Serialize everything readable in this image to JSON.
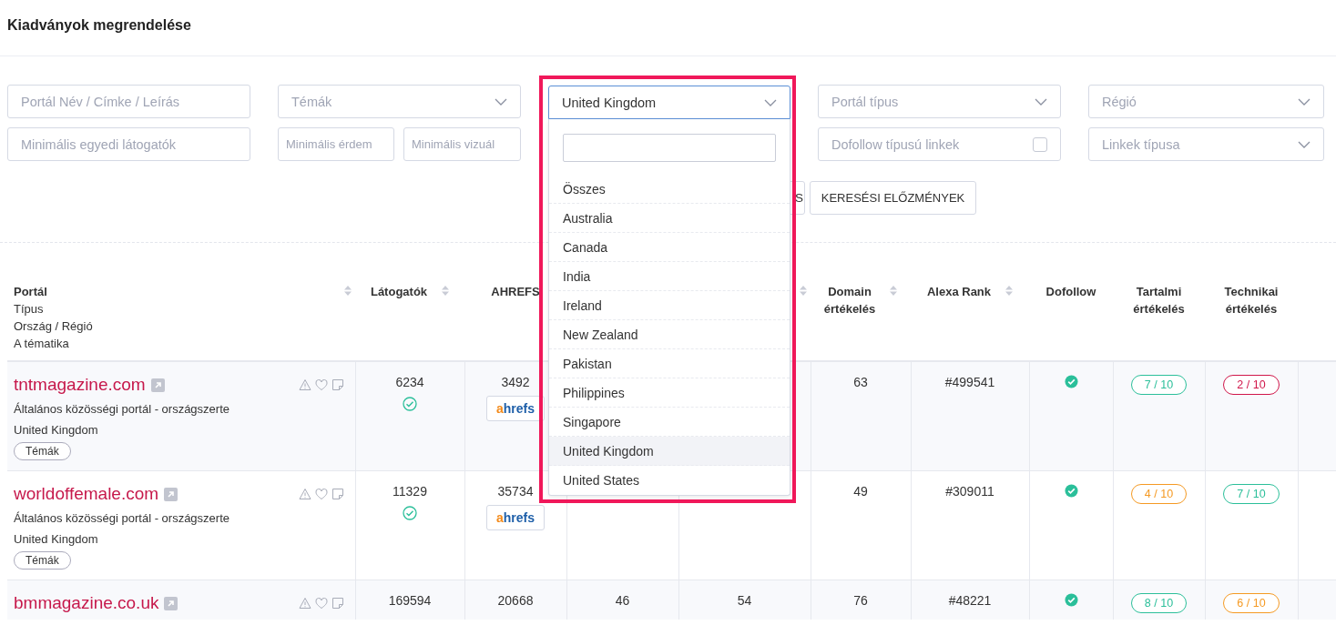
{
  "page_title": "Kiadványok megrendelése",
  "filters": {
    "row_1": [
      {
        "kind": "text",
        "placeholder": "Portál Név / Címke / Leírás"
      },
      {
        "kind": "select",
        "placeholder": "Témák"
      },
      {
        "kind": "dropdown"
      },
      {
        "kind": "select",
        "placeholder": "Portál típus"
      },
      {
        "kind": "select",
        "placeholder": "Régió"
      }
    ],
    "row_2": [
      {
        "kind": "text",
        "placeholder": "Minimális egyedi látogatók"
      },
      {
        "kind": "pair",
        "placeholders": [
          "Minimális érdem",
          "Minimális vizuál"
        ]
      },
      {
        "kind": "blank"
      },
      {
        "kind": "checkbox",
        "label": "Dofollow típusú linkek",
        "checked": false
      },
      {
        "kind": "select",
        "placeholder": "Linkek típusa"
      }
    ]
  },
  "buttons": [
    "S",
    "KERESÉSI ELŐZMÉNYEK"
  ],
  "country_dropdown": {
    "value": "United Kingdom",
    "highlighted": true,
    "search": {
      "kind": "empty"
    },
    "options": [
      {
        "label": "Összes",
        "selected": false
      },
      {
        "label": "Australia",
        "selected": false
      },
      {
        "label": "Canada",
        "selected": false
      },
      {
        "label": "India",
        "selected": false
      },
      {
        "label": "Ireland",
        "selected": false
      },
      {
        "label": "New Zealand",
        "selected": false
      },
      {
        "label": "Pakistan",
        "selected": false
      },
      {
        "label": "Philippines",
        "selected": false
      },
      {
        "label": "Singapore",
        "selected": false
      },
      {
        "label": "United Kingdom",
        "selected": true
      },
      {
        "label": "United States",
        "selected": false
      }
    ]
  },
  "table": {
    "columns": [
      {
        "lines": [
          "**Portál**",
          "Típus",
          "Ország / Régió",
          "A tématika"
        ],
        "sortable": true
      },
      {
        "lines": [
          "Látogatók"
        ],
        "sortable": true
      },
      {
        "lines": [
          "AHREFS"
        ],
        "sortable": false
      },
      {},
      {
        "sortable": true
      },
      {
        "lines": [
          "Domain",
          "értékelés"
        ],
        "sortable": true
      },
      {
        "lines": [
          "Alexa Rank"
        ],
        "sortable": true
      },
      {
        "lines": [
          "Dofollow"
        ],
        "sortable": false
      },
      {
        "lines": [
          "Tartalmi",
          "értékelés"
        ],
        "sortable": false
      },
      {
        "lines": [
          "Technikai",
          "értékelés"
        ],
        "sortable": false
      },
      {}
    ],
    "rows": [
      {
        "portal": "tntmagazine.com",
        "type": "Általános közösségi portál - országszerte",
        "country": "United Kingdom",
        "topics": "Témák",
        "visitors": "6234",
        "verified": true,
        "ahrefs": "3492",
        "ahrefs_logo": [
          "a",
          "hrefs"
        ],
        "domain": "63",
        "alexa": "#499541",
        "dofollow": true,
        "content_score": {
          "text": "7 / 10",
          "color": "#2bbf9a"
        },
        "technical_score": {
          "text": "2 / 10",
          "color": "#d0174a"
        }
      },
      {
        "portal": "worldoffemale.com",
        "type": "Általános közösségi portál - országszerte",
        "country": "United Kingdom",
        "topics": "Témák",
        "visitors": "11329",
        "verified": true,
        "ahrefs": "35734",
        "ahrefs_logo": [
          "a",
          "hrefs"
        ],
        "domain": "49",
        "alexa": "#309011",
        "dofollow": true,
        "content_score": {
          "text": "4 / 10",
          "color": "#f59a23"
        },
        "technical_score": {
          "text": "7 / 10",
          "color": "#2bbf9a"
        }
      },
      {
        "portal": "bmmagazine.co.uk",
        "visitors": "169594",
        "ahrefs": "20668",
        "column_4": "46",
        "column_5": "54",
        "domain": "76",
        "alexa": "#48221",
        "dofollow": true,
        "content_score": {
          "text": "8 / 10",
          "color": "#2bbf9a"
        },
        "technical_score": {
          "text": "6 / 10",
          "color": "#f59a23"
        }
      }
    ]
  }
}
